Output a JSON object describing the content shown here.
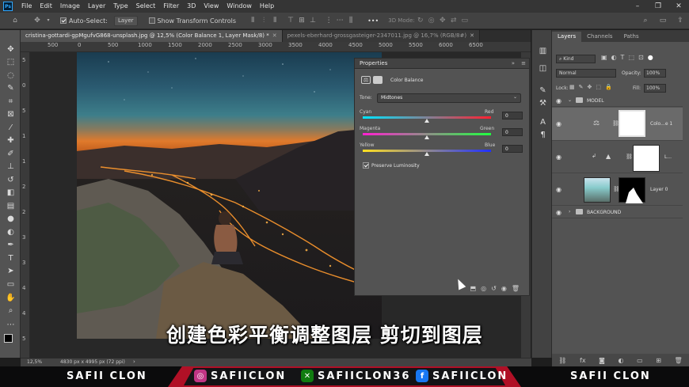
{
  "menu": {
    "logo": "Ps",
    "items": [
      "File",
      "Edit",
      "Image",
      "Layer",
      "Type",
      "Select",
      "Filter",
      "3D",
      "View",
      "Window",
      "Help"
    ],
    "window_controls": [
      "–",
      "❐",
      "✕"
    ]
  },
  "options": {
    "auto_select_label": "Auto-Select:",
    "auto_select_value": "Layer",
    "show_transform_label": "Show Transform Controls",
    "mode_3d_label": "3D Mode:",
    "more": "•••"
  },
  "tabs": [
    {
      "label": "cristina-gottardi-gpMgufvG868-unsplash.jpg @ 12,5% (Color Balance 1, Layer Mask/8) *",
      "active": true
    },
    {
      "label": "pexels-eberhard-grossgasteiger-2347011.jpg @ 16,7% (RGB/8#)",
      "active": false
    }
  ],
  "rulers": {
    "top": [
      "500",
      "0",
      "500",
      "1000",
      "1500",
      "2000",
      "2500",
      "3000",
      "3500",
      "4000",
      "4500",
      "5000",
      "5500",
      "6000",
      "6500"
    ],
    "left": [
      "5",
      "0",
      "5",
      "1",
      "1",
      "2",
      "2",
      "3",
      "3",
      "4",
      "4",
      "5"
    ]
  },
  "properties": {
    "title": "Properties",
    "subtitle": "Color Balance",
    "tone_label": "Tone:",
    "tone_value": "Midtones",
    "sliders": [
      {
        "left": "Cyan",
        "right": "Red",
        "value": "0",
        "position": 0.5
      },
      {
        "left": "Magenta",
        "right": "Green",
        "value": "0",
        "position": 0.5
      },
      {
        "left": "Yellow",
        "right": "Blue",
        "value": "0",
        "position": 0.5
      }
    ],
    "preserve_luminosity": "Preserve Luminosity"
  },
  "layers_panel": {
    "tabs": [
      "Layers",
      "Channels",
      "Paths"
    ],
    "kind_label": "Kind",
    "blend_mode": "Normal",
    "opacity_label": "Opacity:",
    "opacity_value": "100%",
    "lock_label": "Lock:",
    "fill_label": "Fill:",
    "fill_value": "100%",
    "layers": [
      {
        "name": "MODEL",
        "type": "group"
      },
      {
        "name": "Colo...e 1",
        "type": "adjustment"
      },
      {
        "name": "L...",
        "type": "adjustment"
      },
      {
        "name": "Layer 0",
        "type": "pixel"
      },
      {
        "name": "BACKGROUND",
        "type": "group"
      }
    ]
  },
  "status": {
    "zoom": "12,5%",
    "doc_info": "4830 px x 4995 px (72 ppi)"
  },
  "subtitle": "创建色彩平衡调整图层 剪切到图层",
  "branding": {
    "left_name": "SAFII CLON",
    "right_name": "SAFII CLON",
    "socials": [
      {
        "icon": "instagram-icon",
        "label": "SAFIICLON",
        "color": "#c13584"
      },
      {
        "icon": "xbox-icon",
        "label": "SAFIICLON36",
        "color": "#107c10"
      },
      {
        "icon": "facebook-icon",
        "label": "SAFIICLON",
        "color": "#1877f2"
      }
    ]
  }
}
